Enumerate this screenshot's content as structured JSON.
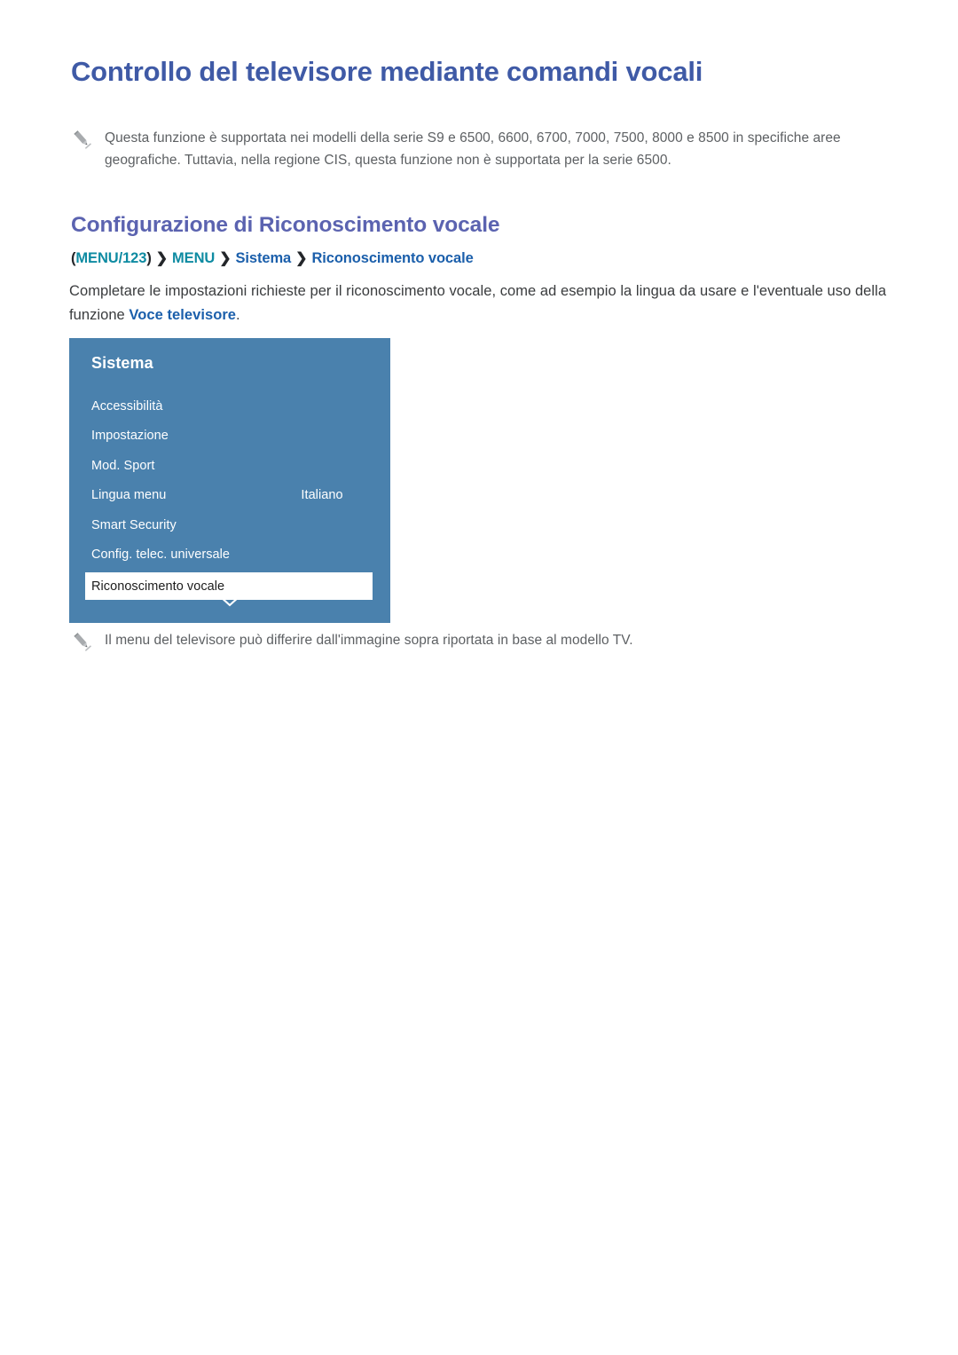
{
  "document": {
    "h1": "Controllo del televisore mediante comandi vocali",
    "h2": "Configurazione di Riconoscimento vocale"
  },
  "notes": {
    "top": "Questa funzione è supportata nei modelli della serie S9 e 6500, 6600, 6700, 7000, 7500, 8000 e 8500 in specifiche aree geografiche. Tuttavia, nella regione CIS, questa funzione non è supportata per la serie 6500.",
    "bottom": "Il menu del televisore può differire dall'immagine sopra riportata in base al modello TV.",
    "icon": "pencil-icon"
  },
  "breadcrumb": {
    "open_paren": "(",
    "menu123": "MENU/123",
    "close_paren": ")",
    "separator": "❯",
    "menu": "MENU",
    "sistema": "Sistema",
    "riconoscimento": "Riconoscimento vocale"
  },
  "paragraph": {
    "lead": "Completare le impostazioni richieste per il riconoscimento vocale, come ad esempio la lingua da usare e l'eventuale uso della funzione ",
    "emphasis": "Voce televisore",
    "tail": "."
  },
  "tv_menu": {
    "title": "Sistema",
    "items": [
      {
        "label": "Accessibilità",
        "value": ""
      },
      {
        "label": "Impostazione",
        "value": ""
      },
      {
        "label": "Mod. Sport",
        "value": ""
      },
      {
        "label": "Lingua menu",
        "value": "Italiano"
      },
      {
        "label": "Smart Security",
        "value": ""
      },
      {
        "label": "Config. telec. universale",
        "value": ""
      }
    ],
    "selected_item": {
      "label": "Riconoscimento vocale",
      "value": ""
    },
    "scroll_icon": "chevron-down-icon"
  },
  "colors": {
    "h1": "#3f5aa6",
    "h2": "#5b63b0",
    "breadcrumb_teal": "#0e8ba2",
    "breadcrumb_blue": "#1b5fab",
    "body_text": "#3a3c3e",
    "note_text": "#5d6063",
    "panel_bg": "#4a81ad",
    "panel_selected_bg": "#ffffff",
    "page_bg": "#ffffff"
  }
}
